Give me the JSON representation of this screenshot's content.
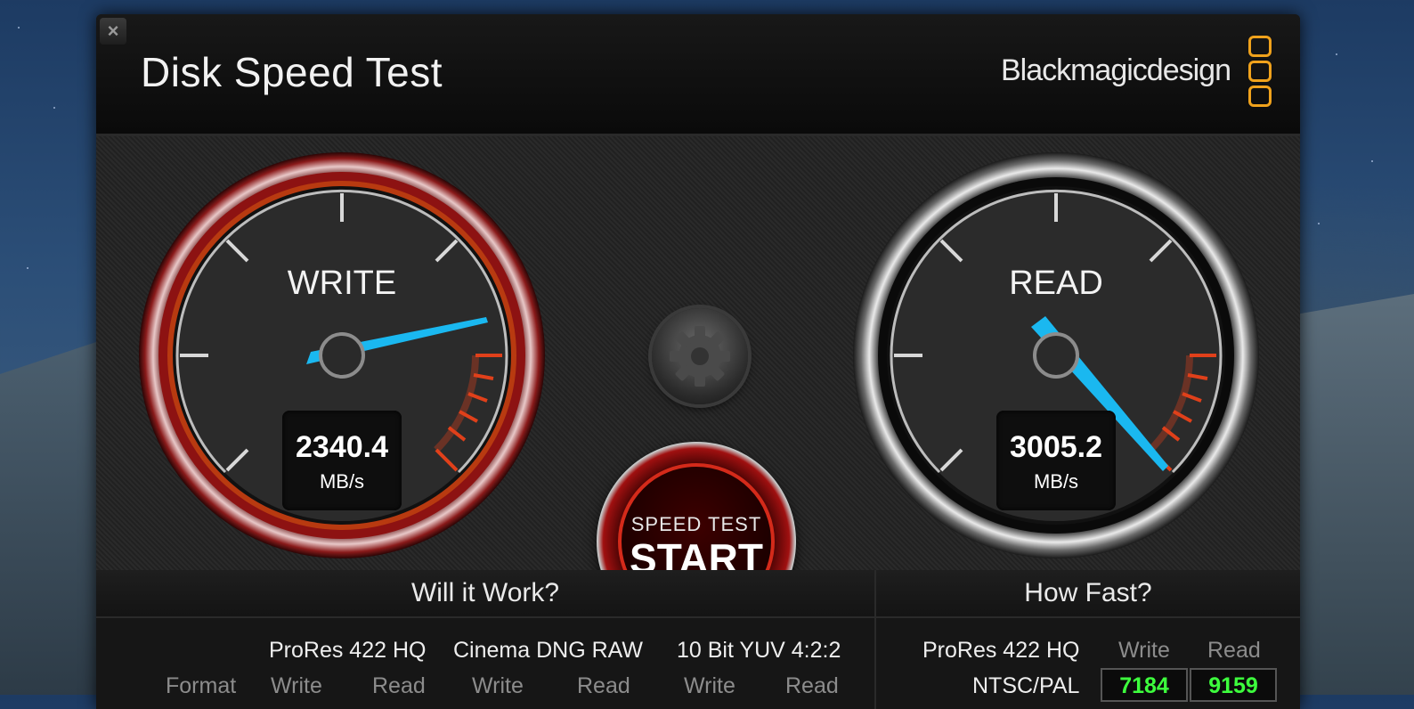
{
  "app": {
    "title": "Disk Speed Test",
    "brand": "Blackmagicdesign",
    "close_label": "×"
  },
  "gauges": {
    "write": {
      "label": "WRITE",
      "value": "2340.4",
      "unit": "MB/s"
    },
    "read": {
      "label": "READ",
      "value": "3005.2",
      "unit": "MB/s"
    }
  },
  "controls": {
    "start_small": "SPEED TEST",
    "start_big": "START",
    "settings_icon": "gear-icon"
  },
  "will_it_work": {
    "title": "Will it Work?",
    "format_label": "Format",
    "formats": [
      {
        "name": "ProRes 422 HQ",
        "write": "Write",
        "read": "Read"
      },
      {
        "name": "Cinema DNG RAW",
        "write": "Write",
        "read": "Read"
      },
      {
        "name": "10 Bit YUV 4:2:2",
        "write": "Write",
        "read": "Read"
      }
    ]
  },
  "how_fast": {
    "title": "How Fast?",
    "codec": "ProRes 422 HQ",
    "write_header": "Write",
    "read_header": "Read",
    "rows": [
      {
        "name": "NTSC/PAL",
        "write": "7184",
        "read": "9159"
      }
    ]
  },
  "colors": {
    "accent_red": "#d42a1a",
    "needle_blue": "#1ab8f0",
    "brand_orange": "#f0a21c",
    "speed_green": "#3dff3d"
  }
}
